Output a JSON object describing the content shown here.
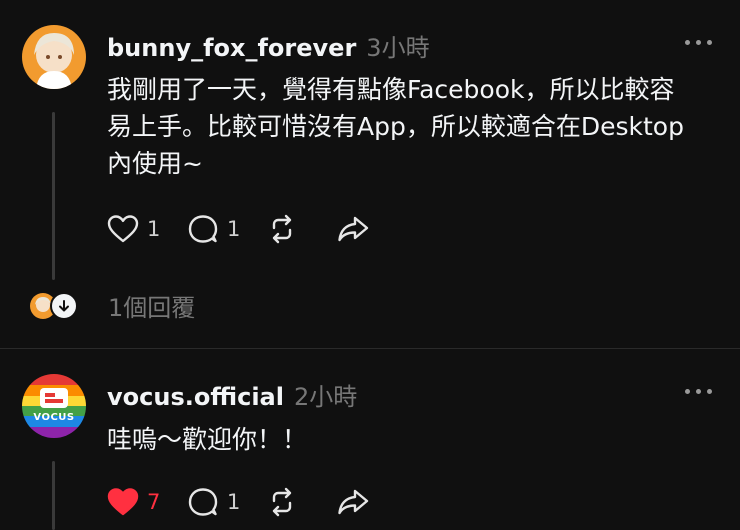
{
  "posts": [
    {
      "username": "bunny_fox_forever",
      "time": "3小時",
      "text_lines": [
        "我剛用了一天，覺得有點像Facebook，所以比較容",
        "易上手。比較可惜沒有App，所以較適合在Desktop",
        "內使用~"
      ],
      "likes": "1",
      "comments": "1",
      "liked": false,
      "replies_label": "1個回覆"
    },
    {
      "username": "vocus.official",
      "time": "2小時",
      "text_lines": [
        "哇嗚～歡迎你！！"
      ],
      "likes": "7",
      "comments": "1",
      "liked": true,
      "avatar_text": "VOCUS"
    }
  ],
  "colors": {
    "background": "#101010",
    "like_active": "#ff3040",
    "muted_text": "#777777",
    "avatar1_bg": "#f29b2f",
    "avatar2_rainbow": [
      "#e53935",
      "#fb8c00",
      "#fdd835",
      "#43a047",
      "#1e88e5",
      "#8e24aa"
    ]
  },
  "icons": {
    "like": "heart-icon",
    "comment": "comment-bubble-icon",
    "repost": "repost-icon",
    "share": "share-arrow-icon",
    "more": "more-dots-icon",
    "reply_expand": "arrow-down-circle-icon"
  }
}
